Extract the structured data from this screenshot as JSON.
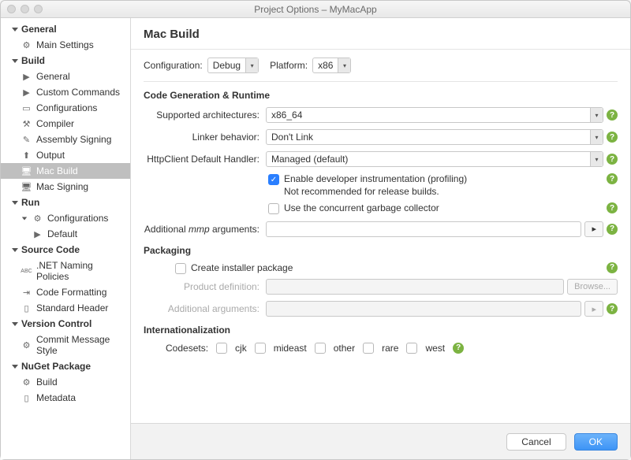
{
  "window": {
    "title": "Project Options – MyMacApp"
  },
  "sidebar": {
    "groups": [
      {
        "label": "General",
        "items": [
          {
            "label": "Main Settings",
            "icon": "gear-icon"
          }
        ]
      },
      {
        "label": "Build",
        "items": [
          {
            "label": "General",
            "icon": "play-icon"
          },
          {
            "label": "Custom Commands",
            "icon": "play-icon"
          },
          {
            "label": "Configurations",
            "icon": "window-icon"
          },
          {
            "label": "Compiler",
            "icon": "hammer-icon"
          },
          {
            "label": "Assembly Signing",
            "icon": "pen-icon"
          },
          {
            "label": "Output",
            "icon": "upload-icon"
          },
          {
            "label": "Mac Build",
            "icon": "monitor-icon",
            "selected": true
          },
          {
            "label": "Mac Signing",
            "icon": "monitor-icon"
          }
        ]
      },
      {
        "label": "Run",
        "items": [
          {
            "label": "Configurations",
            "icon": "gear-icon",
            "children": [
              {
                "label": "Default",
                "icon": "play-icon"
              }
            ]
          }
        ]
      },
      {
        "label": "Source Code",
        "items": [
          {
            "label": ".NET Naming Policies",
            "icon": "abc-icon"
          },
          {
            "label": "Code Formatting",
            "icon": "brackets-icon"
          },
          {
            "label": "Standard Header",
            "icon": "doc-icon"
          }
        ]
      },
      {
        "label": "Version Control",
        "items": [
          {
            "label": "Commit Message Style",
            "icon": "gear-icon"
          }
        ]
      },
      {
        "label": "NuGet Package",
        "items": [
          {
            "label": "Build",
            "icon": "gear-icon"
          },
          {
            "label": "Metadata",
            "icon": "doc-icon"
          }
        ]
      }
    ]
  },
  "main": {
    "title": "Mac Build",
    "configuration_label": "Configuration:",
    "configuration_value": "Debug",
    "platform_label": "Platform:",
    "platform_value": "x86",
    "section_codegen": "Code Generation & Runtime",
    "arch_label": "Supported architectures:",
    "arch_value": "x86_64",
    "linker_label": "Linker behavior:",
    "linker_value": "Don't Link",
    "http_label": "HttpClient Default Handler:",
    "http_value": "Managed (default)",
    "chk_profiling_line1": "Enable developer instrumentation (profiling)",
    "chk_profiling_line2": "Not recommended for release builds.",
    "chk_gc": "Use the concurrent garbage collector",
    "mmp_label": "Additional mmp arguments:",
    "section_packaging": "Packaging",
    "chk_installer": "Create installer package",
    "proddef_label": "Product definition:",
    "browse_label": "Browse...",
    "addlargs_label": "Additional arguments:",
    "section_i18n": "Internationalization",
    "codesets_label": "Codesets:",
    "codesets": [
      "cjk",
      "mideast",
      "other",
      "rare",
      "west"
    ]
  },
  "footer": {
    "cancel": "Cancel",
    "ok": "OK"
  }
}
